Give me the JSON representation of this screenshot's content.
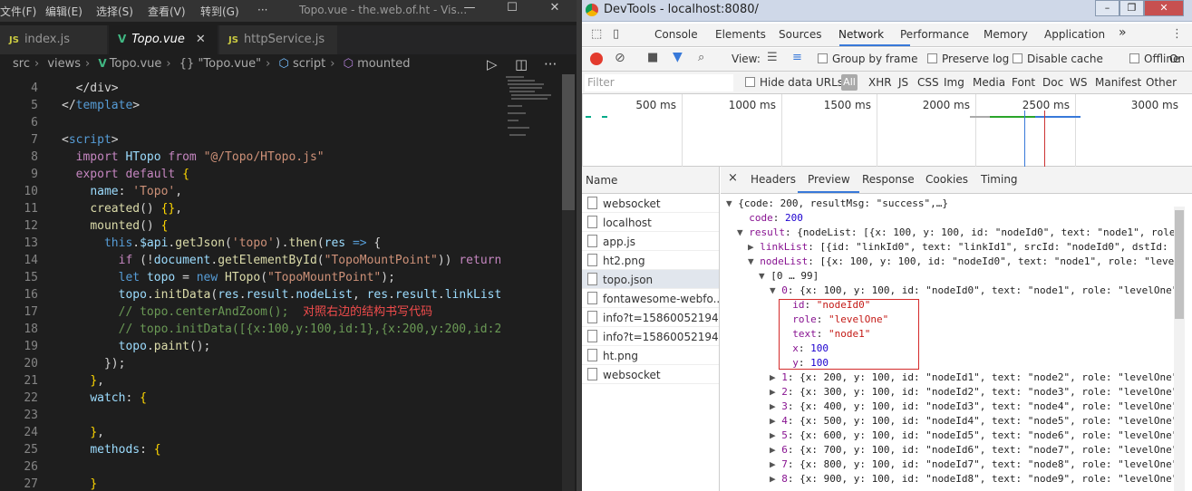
{
  "vscode": {
    "menu": [
      "文件(F)",
      "编辑(E)",
      "选择(S)",
      "查看(V)",
      "转到(G)",
      "···"
    ],
    "window_title": "Topo.vue - the.web.of.ht - Vis...",
    "tabs": [
      {
        "label": "index.js",
        "icon": "JS"
      },
      {
        "label": "Topo.vue",
        "icon": "V"
      },
      {
        "label": "httpService.js",
        "icon": "JS"
      }
    ],
    "breadcrumb": [
      "src",
      "views",
      "Topo.vue",
      "\"Topo.vue\"",
      "script",
      "mounted"
    ],
    "breadcrumb_icons": [
      "{}",
      "⬡",
      "⬡"
    ],
    "code_lines": [
      {
        "no": "4",
        "html": "  <span class='p'>&lt;/div&gt;</span>"
      },
      {
        "no": "5",
        "html": "<span class='p'>&lt;/</span><span class='t'>template</span><span class='p'>&gt;</span>"
      },
      {
        "no": "6",
        "html": ""
      },
      {
        "no": "7",
        "html": "<span class='p'>&lt;</span><span class='t'>script</span><span class='p'>&gt;</span>"
      },
      {
        "no": "8",
        "html": "  <span class='k'>import</span> <span class='v'>HTopo</span> <span class='k'>from</span> <span class='s'>\"@/Topo/HTopo.js\"</span>"
      },
      {
        "no": "9",
        "html": "  <span class='k'>export</span> <span class='k'>default</span> <span class='br'>{</span>"
      },
      {
        "no": "10",
        "html": "    <span class='v'>name</span>: <span class='s'>'Topo'</span>,"
      },
      {
        "no": "11",
        "html": "    <span class='f'>created</span>() <span class='br'>{}</span>,"
      },
      {
        "no": "12",
        "html": "    <span class='f'>mounted</span>() <span class='br'>{</span>"
      },
      {
        "no": "13",
        "html": "      <span class='t'>this</span>.<span class='v'>$api</span>.<span class='f'>getJson</span>(<span class='s'>'topo'</span>).<span class='f'>then</span>(<span class='v'>res</span> <span class='t'>=&gt;</span> {"
      },
      {
        "no": "14",
        "html": "        <span class='k'>if</span> (!<span class='v'>document</span>.<span class='f'>getElementById</span>(<span class='s'>\"TopoMountPoint\"</span>)) <span class='k'>return</span>;"
      },
      {
        "no": "15",
        "html": "        <span class='t'>let</span> <span class='v'>topo</span> = <span class='t'>new</span> <span class='f'>HTopo</span>(<span class='s'>\"TopoMountPoint\"</span>);"
      },
      {
        "no": "16",
        "html": "        <span class='v'>topo</span>.<span class='f'>initData</span>(<span class='v'>res</span>.<span class='v'>result</span>.<span class='v'>nodeList</span>, <span class='v'>res</span>.<span class='v'>result</span>.<span class='v'>linkList</span>)"
      },
      {
        "no": "17",
        "html": "        <span class='c'>// topo.centerAndZoom();</span>  <span class='cn'>对照右边的结构书写代码</span>"
      },
      {
        "no": "18",
        "html": "        <span class='c'>// topo.initData([{x:100,y:100,id:1},{x:200,y:200,id:2}</span>"
      },
      {
        "no": "19",
        "html": "        <span class='v'>topo</span>.<span class='f'>paint</span>();"
      },
      {
        "no": "20",
        "html": "      });"
      },
      {
        "no": "21",
        "html": "    <span class='br'>}</span>,"
      },
      {
        "no": "22",
        "html": "    <span class='v'>watch</span>: <span class='br'>{</span>"
      },
      {
        "no": "23",
        "html": ""
      },
      {
        "no": "24",
        "html": "    <span class='br'>}</span>,"
      },
      {
        "no": "25",
        "html": "    <span class='v'>methods</span>: <span class='br'>{</span>"
      },
      {
        "no": "26",
        "html": ""
      },
      {
        "no": "27",
        "html": "    <span class='br'>}</span>"
      }
    ]
  },
  "devtools": {
    "title": "DevTools - localhost:8080/",
    "main_tabs": [
      "Console",
      "Elements",
      "Sources",
      "Network",
      "Performance",
      "Memory",
      "Application"
    ],
    "more": "»",
    "toolbar": {
      "view": "View:",
      "group": "Group by frame",
      "preserve": "Preserve log",
      "disable": "Disable cache",
      "offline": "Offline",
      "online": "On"
    },
    "filter": {
      "placeholder": "Filter",
      "hide_urls": "Hide data URLs",
      "all": "All",
      "types": [
        "XHR",
        "JS",
        "CSS",
        "Img",
        "Media",
        "Font",
        "Doc",
        "WS",
        "Manifest",
        "Other"
      ]
    },
    "timeline_ticks": [
      "500 ms",
      "1000 ms",
      "1500 ms",
      "2000 ms",
      "2500 ms",
      "3000 ms"
    ],
    "name_header": "Name",
    "requests": [
      "websocket",
      "localhost",
      "app.js",
      "ht2.png",
      "topo.json",
      "fontawesome-webfo...",
      "info?t=1586005219421",
      "info?t=1586005219423",
      "ht.png",
      "websocket"
    ],
    "selected_request": 4,
    "preview_tabs": [
      "×",
      "Headers",
      "Preview",
      "Response",
      "Cookies",
      "Timing"
    ],
    "preview_lines": [
      {
        "i": 0,
        "tri": "▼",
        "html": "{code: 200, resultMsg: \"success\",…}"
      },
      {
        "i": 1,
        "tri": "",
        "html": "<span class='pk'>code</span>: <span class='pn'>200</span>"
      },
      {
        "i": 1,
        "tri": "▼",
        "html": "<span class='pk'>result</span>: {nodeList: [{x: 100, y: 100, id: \"nodeId0\", text: \"node1\", role"
      },
      {
        "i": 2,
        "tri": "▶",
        "html": "<span class='pk'>linkList</span>: [{id: \"linkId0\", text: \"linkId1\", srcId: \"nodeId0\", dstId:"
      },
      {
        "i": 2,
        "tri": "▼",
        "html": "<span class='pk'>nodeList</span>: [{x: 100, y: 100, id: \"nodeId0\", text: \"node1\", role: \"leve"
      },
      {
        "i": 3,
        "tri": "▼",
        "html": "[0 … 99]"
      },
      {
        "i": 4,
        "tri": "▼",
        "html": "<span class='pk'>0</span>: {x: 100, y: 100, id: \"nodeId0\", text: \"node1\", role: \"levelOne\""
      },
      {
        "i": 5,
        "tri": "",
        "html": "<span class='pk'>id</span>: <span class='ps'>\"nodeId0\"</span>"
      },
      {
        "i": 5,
        "tri": "",
        "html": "<span class='pk'>role</span>: <span class='ps'>\"levelOne\"</span>"
      },
      {
        "i": 5,
        "tri": "",
        "html": "<span class='pk'>text</span>: <span class='ps'>\"node1\"</span>"
      },
      {
        "i": 5,
        "tri": "",
        "html": "<span class='pk'>x</span>: <span class='pn'>100</span>"
      },
      {
        "i": 5,
        "tri": "",
        "html": "<span class='pk'>y</span>: <span class='pn'>100</span>"
      },
      {
        "i": 4,
        "tri": "▶",
        "html": "<span class='pk'>1</span>: {x: 200, y: 100, id: \"nodeId1\", text: \"node2\", role: \"levelOne\""
      },
      {
        "i": 4,
        "tri": "▶",
        "html": "<span class='pk'>2</span>: {x: 300, y: 100, id: \"nodeId2\", text: \"node3\", role: \"levelOne\""
      },
      {
        "i": 4,
        "tri": "▶",
        "html": "<span class='pk'>3</span>: {x: 400, y: 100, id: \"nodeId3\", text: \"node4\", role: \"levelOne\""
      },
      {
        "i": 4,
        "tri": "▶",
        "html": "<span class='pk'>4</span>: {x: 500, y: 100, id: \"nodeId4\", text: \"node5\", role: \"levelOne\""
      },
      {
        "i": 4,
        "tri": "▶",
        "html": "<span class='pk'>5</span>: {x: 600, y: 100, id: \"nodeId5\", text: \"node6\", role: \"levelOne\""
      },
      {
        "i": 4,
        "tri": "▶",
        "html": "<span class='pk'>6</span>: {x: 700, y: 100, id: \"nodeId6\", text: \"node7\", role: \"levelOne\""
      },
      {
        "i": 4,
        "tri": "▶",
        "html": "<span class='pk'>7</span>: {x: 800, y: 100, id: \"nodeId7\", text: \"node8\", role: \"levelOne\""
      },
      {
        "i": 4,
        "tri": "▶",
        "html": "<span class='pk'>8</span>: {x: 900, y: 100, id: \"nodeId8\", text: \"node9\", role: \"levelOne\""
      }
    ]
  }
}
